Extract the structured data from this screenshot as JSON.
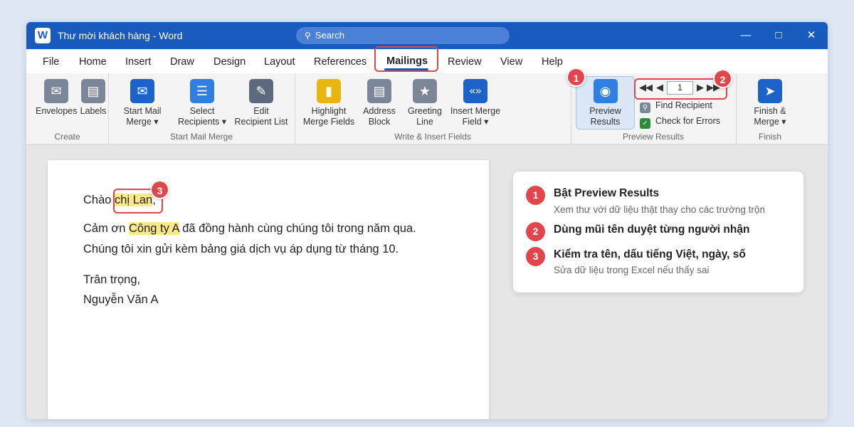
{
  "window": {
    "title": "Thư mời khách hàng - Word",
    "app_logo": "W"
  },
  "search": {
    "label": "Search"
  },
  "controls": {
    "minimize": "—",
    "maximize": "□",
    "close": "✕"
  },
  "tabs": [
    "File",
    "Home",
    "Insert",
    "Draw",
    "Design",
    "Layout",
    "References",
    "Mailings",
    "Review",
    "View",
    "Help"
  ],
  "active_tab": "Mailings",
  "ribbon": {
    "create": {
      "label": "Create",
      "envelopes": "Envelopes",
      "labels": "Labels"
    },
    "start": {
      "label": "Start Mail Merge",
      "start_l1": "Start Mail",
      "start_l2": "Merge ▾",
      "select_l1": "Select",
      "select_l2": "Recipients ▾",
      "edit_l1": "Edit",
      "edit_l2": "Recipient List"
    },
    "write": {
      "label": "Write & Insert Fields",
      "highlight_l1": "Highlight",
      "highlight_l2": "Merge Fields",
      "address_l1": "Address",
      "address_l2": "Block",
      "greeting_l1": "Greeting",
      "greeting_l2": "Line",
      "insert_l1": "Insert Merge",
      "insert_l2": "Field ▾"
    },
    "preview": {
      "label": "Preview Results",
      "btn_l1": "Preview",
      "btn_l2": "Results",
      "record": "1",
      "find": "Find Recipient",
      "check": "Check for Errors"
    },
    "finish": {
      "label": "Finish",
      "btn_l1": "Finish &",
      "btn_l2": "Merge ▾"
    }
  },
  "badges": [
    "1",
    "2",
    "3"
  ],
  "document": {
    "greeting_pre": "Chào ",
    "greeting_name": "chị Lan",
    "greeting_post": ",",
    "line1_pre": "Cảm ơn ",
    "line1_company": "Công ty A",
    "line1_post": " đã đồng hành cùng chúng tôi trong năm qua.",
    "line2": "Chúng tôi xin gửi kèm bảng giá dịch vụ áp dụng từ tháng 10.",
    "closing": "Trân trọng,",
    "signature": "Nguyễn Văn A"
  },
  "steps": [
    {
      "num": "1",
      "title": "Bật Preview Results",
      "sub": "Xem thư với dữ liệu thật thay cho các trường trộn"
    },
    {
      "num": "2",
      "title": "Dùng mũi tên duyệt từng người nhận",
      "sub": ""
    },
    {
      "num": "3",
      "title": "Kiểm tra tên, dấu tiếng Việt, ngày, số",
      "sub": "Sửa dữ liệu trong Excel nếu thấy sai"
    }
  ],
  "colors": {
    "title_bar": "#185abd",
    "accent_red": "#e0464c",
    "highlight": "#fbe98a"
  }
}
